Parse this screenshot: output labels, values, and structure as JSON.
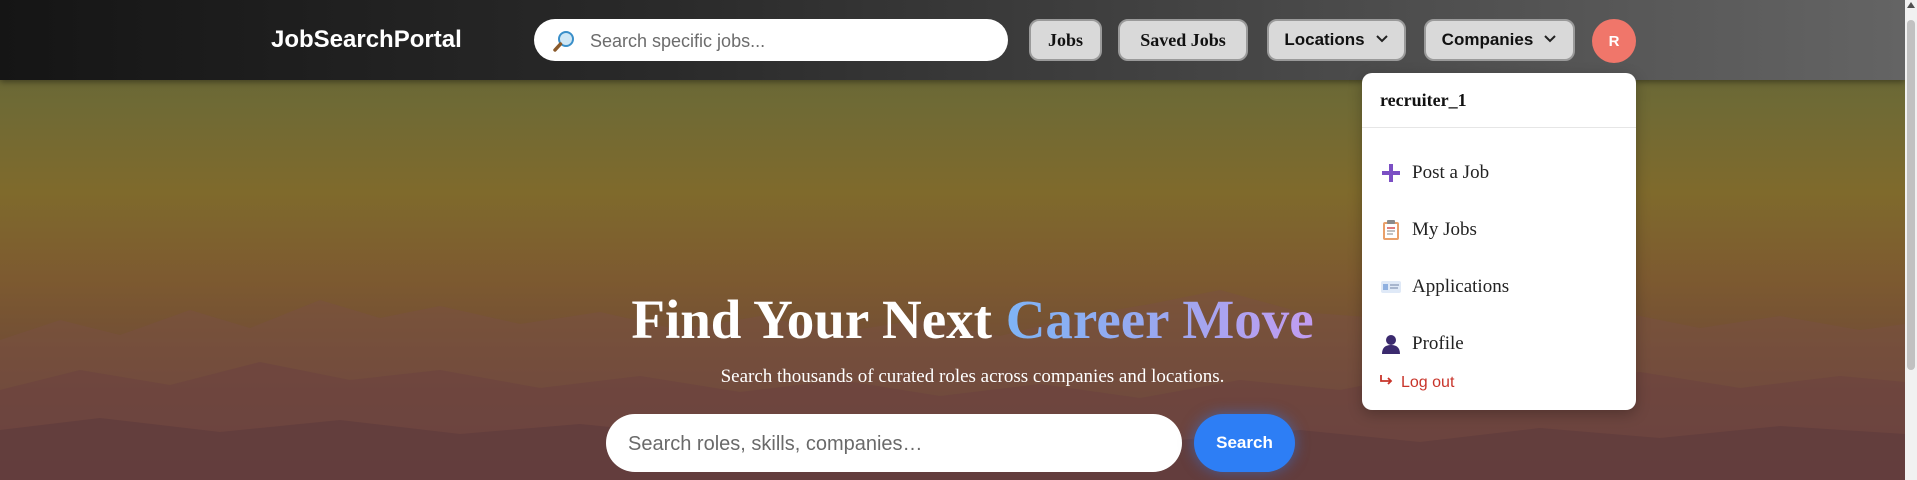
{
  "navbar": {
    "brand": "JobSearchPortal",
    "search_placeholder": "Search specific jobs...",
    "jobs_label": "Jobs",
    "saved_jobs_label": "Saved Jobs",
    "locations_label": "Locations",
    "companies_label": "Companies",
    "avatar_initial": "R"
  },
  "user_menu": {
    "username": "recruiter_1",
    "items": [
      {
        "label": "Post a Job",
        "icon": "plus-icon"
      },
      {
        "label": "My Jobs",
        "icon": "clipboard-icon"
      },
      {
        "label": "Applications",
        "icon": "id-card-icon"
      },
      {
        "label": "Profile",
        "icon": "user-icon"
      }
    ],
    "logout_label": "Log out",
    "logout_color": "#c8342a"
  },
  "hero": {
    "title_prefix": "Find Your Next ",
    "title_accent": "Career Move",
    "subtitle": "Search thousands of curated roles across companies and locations.",
    "search_placeholder": "Search roles, skills, companies…",
    "search_button": "Search"
  },
  "colors": {
    "accent_button": "#2d7ef5",
    "avatar_bg": "#f0766a"
  }
}
